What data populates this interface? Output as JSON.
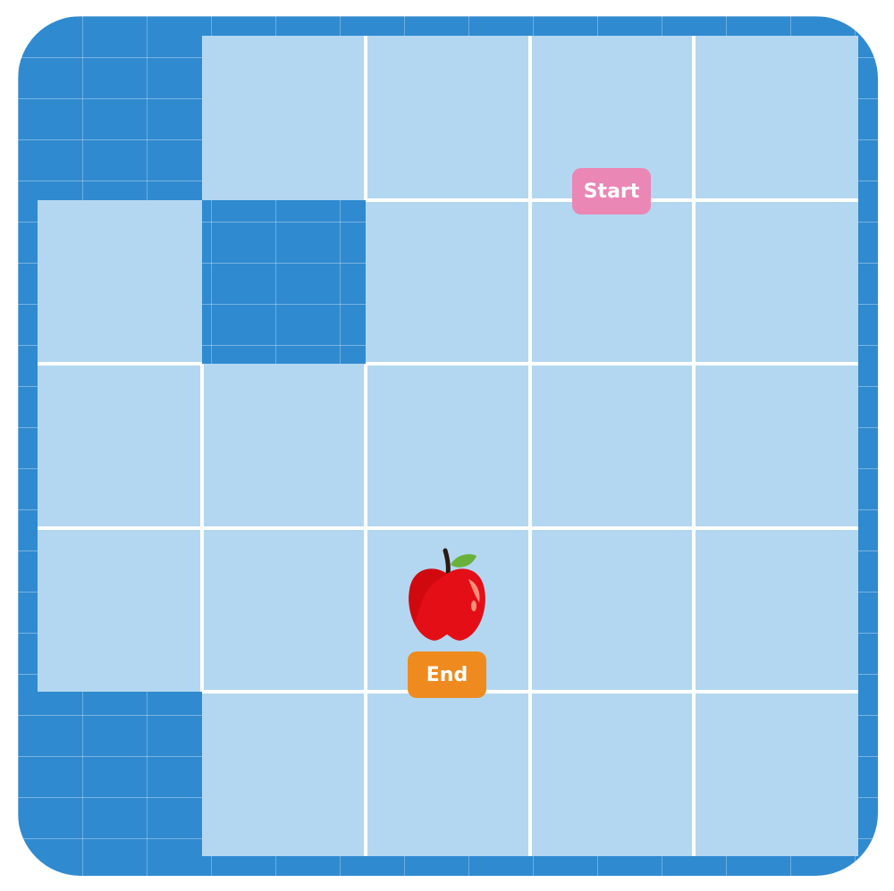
{
  "grid": {
    "rows": 5,
    "cols": 5,
    "walls": [
      [
        0,
        0
      ],
      [
        1,
        1
      ],
      [
        4,
        0
      ]
    ],
    "colors": {
      "floor": "#b3d7f1",
      "wall": "#308ad0",
      "line": "#ffffff"
    }
  },
  "start": {
    "label": "Start",
    "row": 0,
    "col": 3,
    "color": "#ea87b5"
  },
  "end": {
    "label": "End",
    "row": 3,
    "col": 2,
    "color": "#ef8a1f"
  },
  "goal": {
    "icon": "apple-icon",
    "row": 3,
    "col": 2
  }
}
